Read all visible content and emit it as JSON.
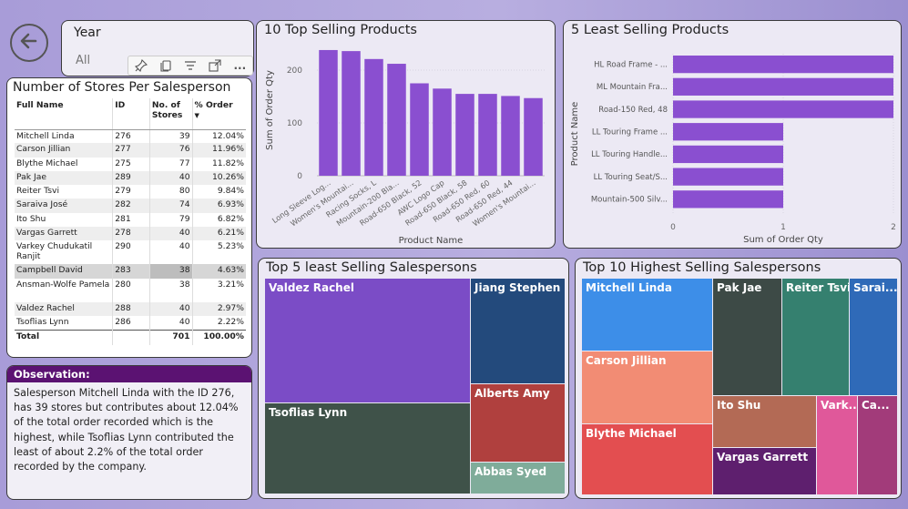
{
  "nav": {
    "back_icon": "arrow-left-circle-icon"
  },
  "year_slicer": {
    "title": "Year",
    "value": "All"
  },
  "toolbar": {
    "icons": [
      "pin-icon",
      "copy-icon",
      "filter-icon",
      "focus-mode-icon",
      "more-options-icon"
    ],
    "more_label": "..."
  },
  "stores_table": {
    "title": "Number of Stores Per Salesperson",
    "headers": [
      "Full Name",
      "ID",
      "No. of Stores",
      "% Order"
    ],
    "rows": [
      [
        "Mitchell Linda",
        "276",
        "39",
        "12.04%"
      ],
      [
        "Carson Jillian",
        "277",
        "76",
        "11.96%"
      ],
      [
        "Blythe Michael",
        "275",
        "77",
        "11.82%"
      ],
      [
        "Pak Jae",
        "289",
        "40",
        "10.26%"
      ],
      [
        "Reiter Tsvi",
        "279",
        "80",
        "9.84%"
      ],
      [
        "Saraiva José",
        "282",
        "74",
        "6.93%"
      ],
      [
        "Ito Shu",
        "281",
        "79",
        "6.82%"
      ],
      [
        "Vargas Garrett",
        "278",
        "40",
        "6.21%"
      ],
      [
        "Varkey Chudukatil Ranjit",
        "290",
        "40",
        "5.23%"
      ],
      [
        "Campbell David",
        "283",
        "38",
        "4.63%"
      ],
      [
        "Ansman-Wolfe Pamela",
        "280",
        "38",
        "3.21%"
      ],
      [
        "Valdez Rachel",
        "288",
        "40",
        "2.97%"
      ],
      [
        "Tsoflias Lynn",
        "286",
        "40",
        "2.22%"
      ]
    ],
    "total": [
      "Total",
      "",
      "701",
      "100.00%"
    ]
  },
  "observation": {
    "title": "Observation:",
    "text": "Salesperson Mitchell Linda with the ID 276, has 39 stores but contributes about 12.04%  of the total order recorded which is the highest, while Tsoflias Lynn contributed the least of about 2.2% of the total order recorded by the company."
  },
  "top10": {
    "title": "10 Top Selling Products"
  },
  "least5": {
    "title": "5 Least Selling Products"
  },
  "tm_least": {
    "title": "Top 5 least Selling Salespersons",
    "cells": [
      {
        "label": "Valdez Rachel",
        "color": "#7b4cc6"
      },
      {
        "label": "Jiang Stephen",
        "color": "#234a7c"
      },
      {
        "label": "Tsoflias Lynn",
        "color": "#3f5249"
      },
      {
        "label": "Alberts Amy",
        "color": "#b0403e"
      },
      {
        "label": "Abbas Syed",
        "color": "#7fac9a"
      }
    ]
  },
  "tm_top": {
    "title": "Top 10 Highest Selling Salespersons",
    "cells": [
      {
        "label": "Mitchell Linda",
        "color": "#3d8ee8"
      },
      {
        "label": "Pak Jae",
        "color": "#3d4a46"
      },
      {
        "label": "Reiter Tsvi",
        "color": "#35806f"
      },
      {
        "label": "Sarai...",
        "color": "#2f6ab8"
      },
      {
        "label": "Carson Jillian",
        "color": "#f28c74"
      },
      {
        "label": "Ito Shu",
        "color": "#b36a55"
      },
      {
        "label": "Vark...",
        "color": "#e0589a"
      },
      {
        "label": "Ca...",
        "color": "#a23b7a"
      },
      {
        "label": "Blythe Michael",
        "color": "#e34e50"
      },
      {
        "label": "Vargas Garrett",
        "color": "#5e1f6e"
      }
    ]
  },
  "chart_data": [
    {
      "type": "bar",
      "title": "10 Top Selling Products",
      "xlabel": "Product Name",
      "ylabel": "Sum of Order Qty",
      "categories": [
        "Long Sleeve Log...",
        "Women's Mountai...",
        "Racing Socks, L",
        "Mountain-200 Bla...",
        "Road-650 Black, 52",
        "AWC Logo Cap",
        "Road-650 Black, 58",
        "Road-650 Red, 60",
        "Road-650 Red, 44",
        "Women's Mountai..."
      ],
      "values": [
        238,
        236,
        221,
        212,
        175,
        165,
        155,
        155,
        151,
        147
      ],
      "yticks": [
        "0",
        "100",
        "200"
      ],
      "ylim": [
        0,
        250
      ],
      "color": "#8a4fd0"
    },
    {
      "type": "bar",
      "orientation": "horizontal",
      "title": "5 Least Selling Products",
      "xlabel": "Sum of Order Qty",
      "ylabel": "Product Name",
      "categories": [
        "HL Road Frame - ...",
        "ML Mountain Fra...",
        "Road-150 Red, 48",
        "LL Touring Frame ...",
        "LL Touring Handle...",
        "LL Touring Seat/S...",
        "Mountain-500 Silv..."
      ],
      "values": [
        2,
        2,
        2,
        1,
        1,
        1,
        1
      ],
      "xticks": [
        "0",
        "1",
        "2"
      ],
      "xlim": [
        0,
        2
      ],
      "color": "#8a4fd0"
    }
  ]
}
